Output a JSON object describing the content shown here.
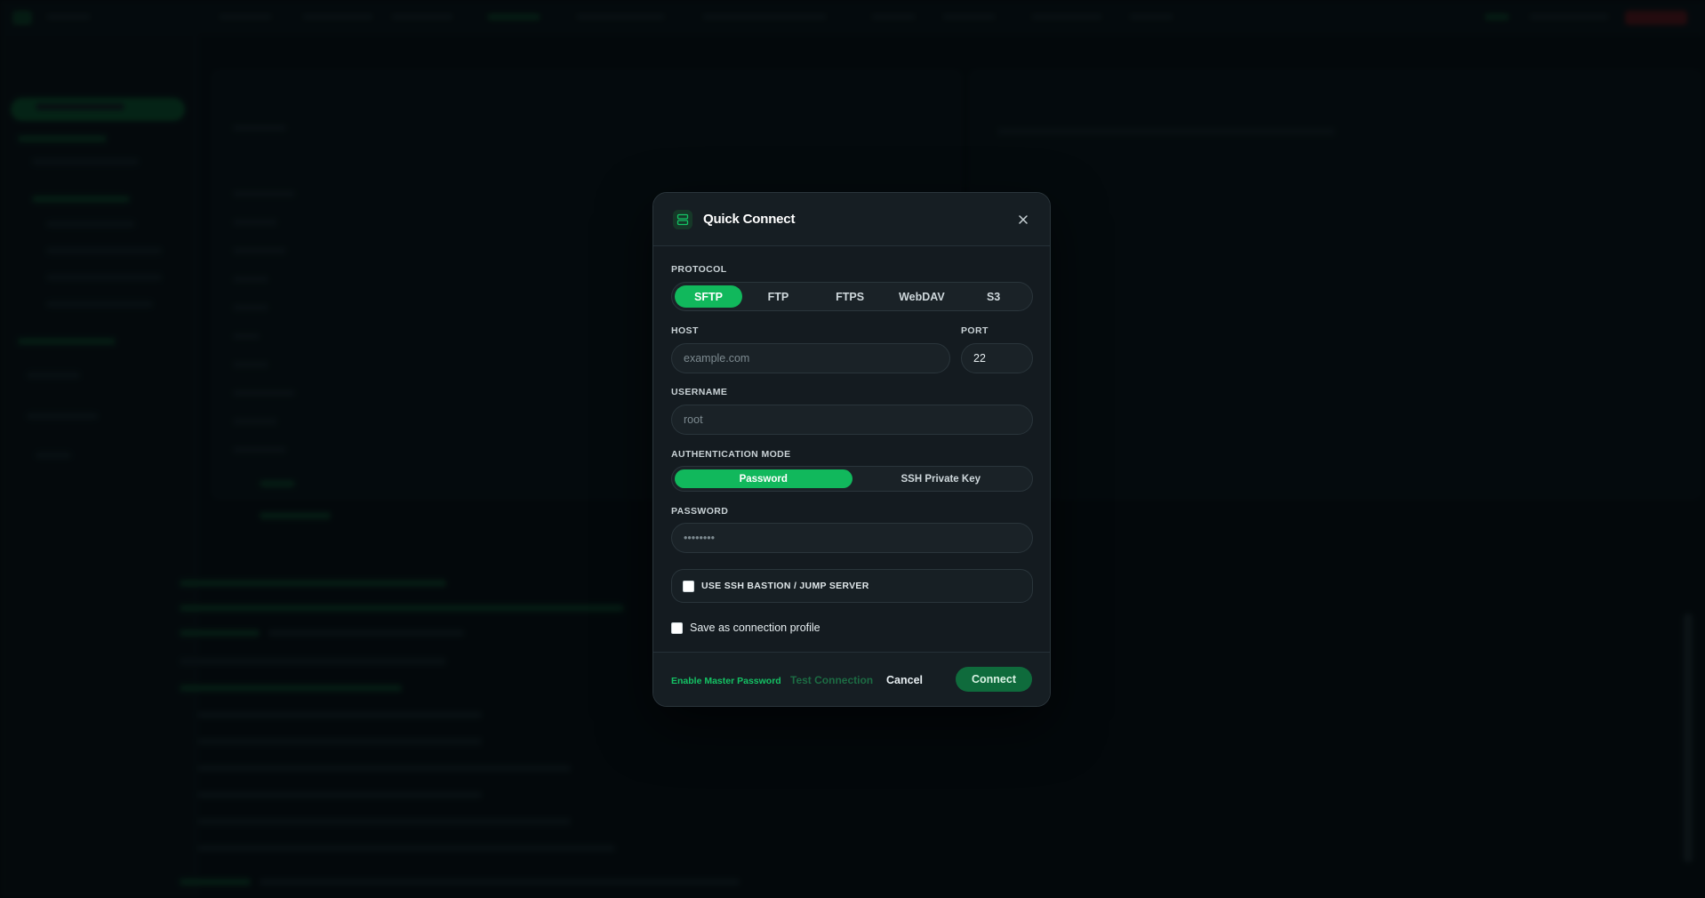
{
  "modal": {
    "title": "Quick Connect",
    "protocol": {
      "label": "PROTOCOL",
      "options": [
        "SFTP",
        "FTP",
        "FTPS",
        "WebDAV",
        "S3"
      ],
      "selected": "SFTP"
    },
    "host": {
      "label": "HOST",
      "placeholder": "example.com",
      "value": ""
    },
    "port": {
      "label": "PORT",
      "value": "22"
    },
    "username": {
      "label": "USERNAME",
      "placeholder": "root",
      "value": ""
    },
    "auth_mode": {
      "label": "AUTHENTICATION MODE",
      "options": [
        "Password",
        "SSH Private Key"
      ],
      "selected": "Password"
    },
    "password": {
      "label": "PASSWORD",
      "placeholder": "••••••••",
      "value": ""
    },
    "bastion": {
      "label": "USE SSH BASTION / JUMP SERVER",
      "checked": false
    },
    "save_profile": {
      "label": "Save as connection profile",
      "checked": false
    },
    "footer": {
      "master_password": "Enable Master Password",
      "test_connection": "Test Connection",
      "cancel": "Cancel",
      "connect": "Connect"
    }
  },
  "colors": {
    "accent": "#11b85c",
    "connect_button": "#0f6b3c",
    "modal_bg": "#141b20"
  }
}
